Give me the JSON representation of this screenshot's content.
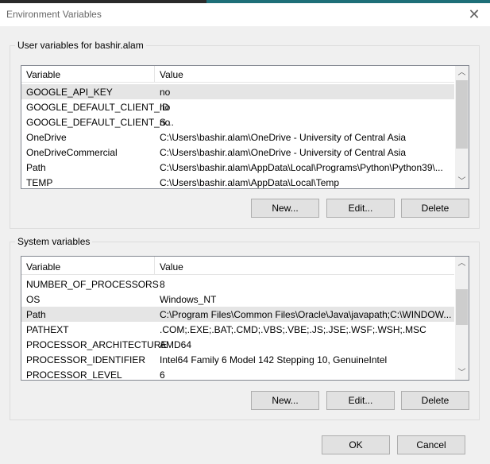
{
  "window": {
    "title": "Environment Variables",
    "close_icon": "close-icon"
  },
  "user": {
    "legend": "User variables for bashir.alam",
    "col_variable": "Variable",
    "col_value": "Value",
    "rows": [
      {
        "name": "GOOGLE_API_KEY",
        "value": "no"
      },
      {
        "name": "GOOGLE_DEFAULT_CLIENT_ID",
        "value": "no"
      },
      {
        "name": "GOOGLE_DEFAULT_CLIENT_S...",
        "value": "no"
      },
      {
        "name": "OneDrive",
        "value": "C:\\Users\\bashir.alam\\OneDrive - University of Central Asia"
      },
      {
        "name": "OneDriveCommercial",
        "value": "C:\\Users\\bashir.alam\\OneDrive - University of Central Asia"
      },
      {
        "name": "Path",
        "value": "C:\\Users\\bashir.alam\\AppData\\Local\\Programs\\Python\\Python39\\..."
      },
      {
        "name": "TEMP",
        "value": "C:\\Users\\bashir.alam\\AppData\\Local\\Temp"
      }
    ],
    "new": "New...",
    "edit": "Edit...",
    "delete": "Delete"
  },
  "system": {
    "legend": "System variables",
    "col_variable": "Variable",
    "col_value": "Value",
    "rows": [
      {
        "name": "NUMBER_OF_PROCESSORS",
        "value": "8"
      },
      {
        "name": "OS",
        "value": "Windows_NT"
      },
      {
        "name": "Path",
        "value": "C:\\Program Files\\Common Files\\Oracle\\Java\\javapath;C:\\WINDOW..."
      },
      {
        "name": "PATHEXT",
        "value": ".COM;.EXE;.BAT;.CMD;.VBS;.VBE;.JS;.JSE;.WSF;.WSH;.MSC"
      },
      {
        "name": "PROCESSOR_ARCHITECTURE",
        "value": "AMD64"
      },
      {
        "name": "PROCESSOR_IDENTIFIER",
        "value": "Intel64 Family 6 Model 142 Stepping 10, GenuineIntel"
      },
      {
        "name": "PROCESSOR_LEVEL",
        "value": "6"
      }
    ],
    "new": "New...",
    "edit": "Edit...",
    "delete": "Delete"
  },
  "footer": {
    "ok": "OK",
    "cancel": "Cancel"
  }
}
